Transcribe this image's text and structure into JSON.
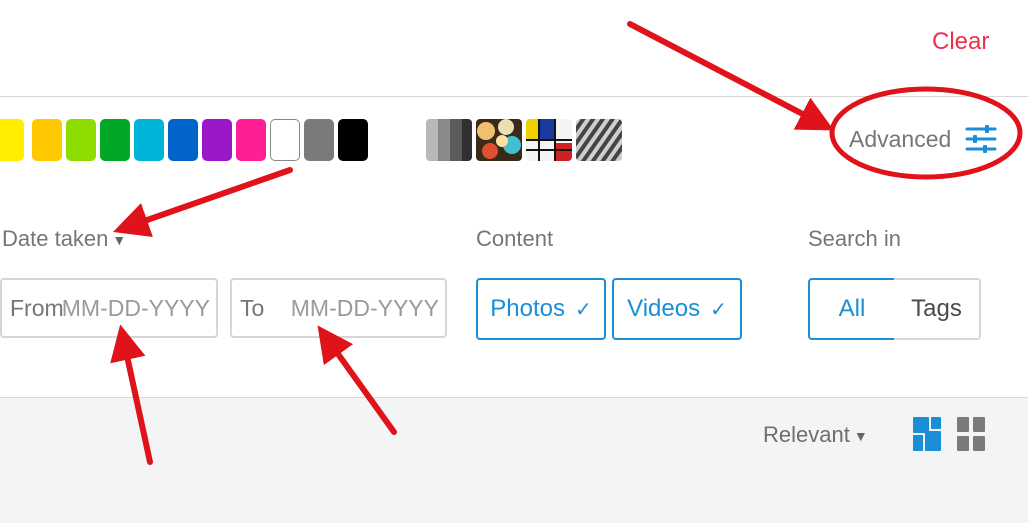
{
  "header": {
    "clear_label": "Clear"
  },
  "colors": {
    "swatches": [
      {
        "name": "yellow",
        "hex": "#ffee00"
      },
      {
        "name": "orange",
        "hex": "#ffc800"
      },
      {
        "name": "lime",
        "hex": "#8fdc00"
      },
      {
        "name": "green",
        "hex": "#00a826"
      },
      {
        "name": "cyan",
        "hex": "#00b4d8"
      },
      {
        "name": "blue",
        "hex": "#0064c8"
      },
      {
        "name": "purple",
        "hex": "#9a18c8"
      },
      {
        "name": "pink",
        "hex": "#ff1e96"
      },
      {
        "name": "white",
        "hex": "#ffffff"
      },
      {
        "name": "gray",
        "hex": "#7a7a7a"
      },
      {
        "name": "black",
        "hex": "#000000"
      }
    ],
    "styles": [
      "black-and-white-style-icon",
      "shallow-depth-of-field-style-icon",
      "minimalist-style-icon",
      "pattern-style-icon"
    ]
  },
  "advanced": {
    "label": "Advanced",
    "icon": "sliders-icon",
    "accent": "#1a8fd6"
  },
  "date": {
    "label": "Date taken",
    "from_label": "From",
    "from_placeholder": "MM-DD-YYYY",
    "to_label": "To",
    "to_placeholder": "MM-DD-YYYY"
  },
  "content": {
    "label": "Content",
    "photos_label": "Photos",
    "videos_label": "Videos",
    "check": "✓"
  },
  "search_in": {
    "label": "Search in",
    "all_label": "All",
    "tags_label": "Tags"
  },
  "results": {
    "sort_label": "Relevant",
    "views": [
      "justified-view-icon",
      "grid-view-icon"
    ]
  },
  "annotation_color": "#e0121a"
}
